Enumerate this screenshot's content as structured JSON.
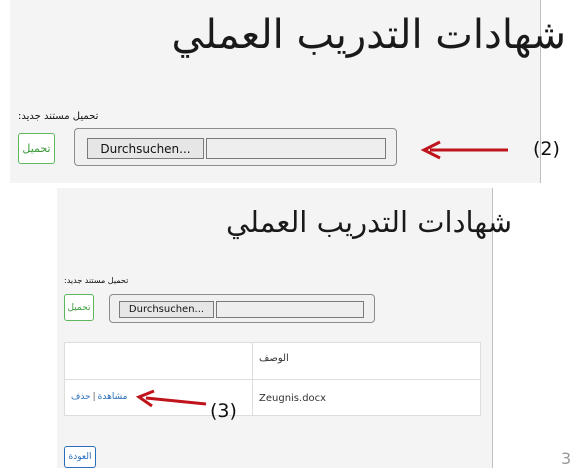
{
  "title": "شهادات التدريب العملي",
  "upload_label": "تحميل مستند جديد:",
  "upload_button": "تحميل",
  "browse_button": "Durchsuchen...",
  "table": {
    "header_description": "الوصف",
    "row_file": "Zeugnis.docx",
    "action_view": "مشاهدة",
    "action_separator": "|",
    "action_delete": "حذف"
  },
  "back_button": "العودة",
  "annotations": {
    "step2": "(2)",
    "step3": "(3)"
  },
  "corner_number": "3",
  "colors": {
    "arrow": "#c0141c",
    "success": "#5cb85c",
    "link": "#2a6ebb"
  }
}
